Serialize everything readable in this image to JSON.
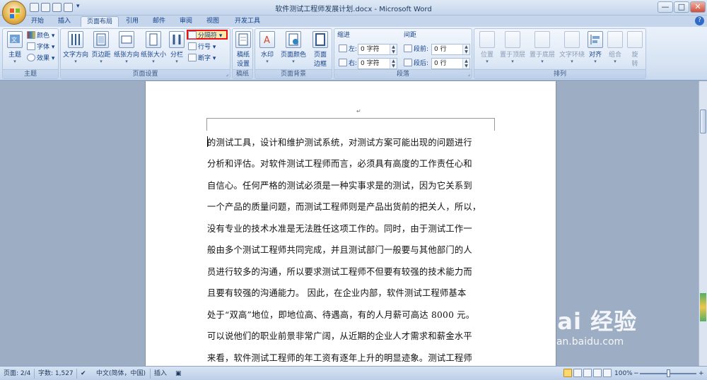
{
  "window": {
    "title": "软件测试工程师发展计划.docx - Microsoft Word",
    "controls": {
      "minimize": "—",
      "maximize": "□",
      "close": "✕"
    },
    "qat_more": "▾"
  },
  "tabs": [
    {
      "label": "开始"
    },
    {
      "label": "插入"
    },
    {
      "label": "页面布局",
      "active": true,
      "highlighted": true
    },
    {
      "label": "引用"
    },
    {
      "label": "邮件"
    },
    {
      "label": "审阅"
    },
    {
      "label": "视图"
    },
    {
      "label": "开发工具"
    }
  ],
  "help_icon": "?",
  "ribbon": {
    "theme_group": {
      "label": "主题",
      "themes": "主题",
      "colors": "颜色 ▾",
      "fonts": "字体 ▾",
      "effects": "效果 ▾"
    },
    "page_setup": {
      "label": "页面设置",
      "text_direction": "文字方向",
      "margins": "页边距",
      "orientation": "纸张方向",
      "size": "纸张大小",
      "columns": "分栏",
      "breaks": "分隔符 ▾",
      "line_numbers": "行号 ▾",
      "hyphenation": "断字 ▾"
    },
    "manuscript": {
      "label": "稿纸",
      "settings_l1": "稿纸",
      "settings_l2": "设置"
    },
    "page_background": {
      "label": "页面背景",
      "watermark": "水印",
      "page_color": "页面颜色",
      "page_border_l1": "页面",
      "page_border_l2": "边框"
    },
    "paragraph": {
      "label": "段落",
      "indent_title": "缩进",
      "spacing_title": "间距",
      "left_label": "左:",
      "left_value": "0 字符",
      "right_label": "右:",
      "right_value": "0 字符",
      "before_label": "段前:",
      "before_value": "0 行",
      "after_label": "段后:",
      "after_value": "0 行"
    },
    "arrange": {
      "label": "排列",
      "position": "位置",
      "bring_front": "置于顶层",
      "send_back": "置于底层",
      "wrap_text": "文字环绕",
      "align": "对齐",
      "group": "组合",
      "rotate_l1": "旋",
      "rotate_l2": "转"
    }
  },
  "document": {
    "header_mark": "↵",
    "lines": [
      "的测试工具，设计和维护测试系统，对测试方案可能出现的问题进行",
      "分析和评估。对软件测试工程师而言，必须具有高度的工作责任心和",
      "自信心。任何严格的测试必须是一种实事求是的测试，因为它关系到",
      "一个产品的质量问题，而测试工程师则是产品出货前的把关人，所以，",
      "没有专业的技术水准是无法胜任这项工作的。同时，由于测试工作一",
      "般由多个测试工程师共同完成，并且测试部门一般要与其他部门的人",
      "员进行较多的沟通，所以要求测试工程师不但要有较强的技术能力而",
      "且要有较强的沟通能力。   因此，在企业内部，软件测试工程师基本",
      "处于“双高”地位，即地位高、待遇高，有的人月薪可高达 8000 元。",
      "可以说他们的职业前景非常广阔，从近期的企业人才需求和薪金水平",
      "来看，软件测试工程师的年工资有逐年上升的明显迹象。测试工程师"
    ]
  },
  "statusbar": {
    "page": "页面: 2/4",
    "words": "字数: 1,527",
    "language": "中文(简体，中国)",
    "mode": "插入",
    "zoom": "100%",
    "zoom_minus": "−",
    "zoom_plus": "+"
  },
  "watermark": {
    "main": "Bai 经验",
    "url": "jingyan.baidu.com"
  },
  "colors": {
    "accent": "#15428b",
    "highlight": "#ee1111",
    "ribbon": "#dde8f6"
  }
}
